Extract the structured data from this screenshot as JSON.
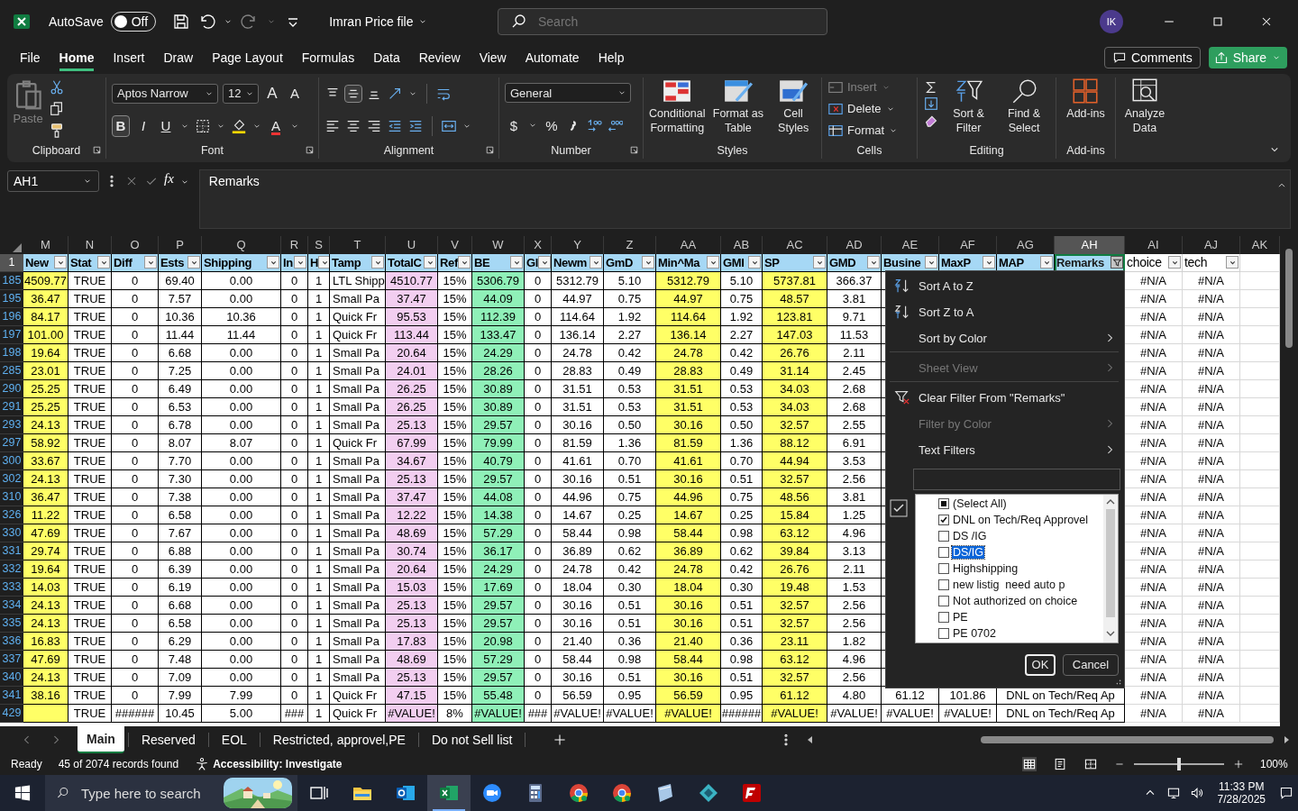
{
  "app": {
    "autosave_label": "AutoSave",
    "autosave": {
      "on": false,
      "label": "Off"
    },
    "title": "Imran Price file",
    "search_placeholder": "Search",
    "avatar": "IK"
  },
  "menu_tabs": [
    {
      "label": "File",
      "selected": false
    },
    {
      "label": "Home",
      "selected": true
    },
    {
      "label": "Insert",
      "selected": false
    },
    {
      "label": "Draw",
      "selected": false
    },
    {
      "label": "Page Layout",
      "selected": false
    },
    {
      "label": "Formulas",
      "selected": false
    },
    {
      "label": "Data",
      "selected": false
    },
    {
      "label": "Review",
      "selected": false
    },
    {
      "label": "View",
      "selected": false
    },
    {
      "label": "Automate",
      "selected": false
    },
    {
      "label": "Help",
      "selected": false
    }
  ],
  "comments": "Comments",
  "share": "Share",
  "ribbon": {
    "clipboard": {
      "label": "Clipboard",
      "paste": "Paste",
      "paste_disabled": true
    },
    "font": {
      "label": "Font",
      "family": "Aptos Narrow",
      "size": "12",
      "grow": "A",
      "shrink": "A",
      "bold": "B",
      "bold_on": true,
      "italic": "I",
      "underline": "U",
      "font_color": "A"
    },
    "alignment": {
      "label": "Alignment",
      "middle_on": true
    },
    "number": {
      "label": "Number",
      "format": "General",
      "currency": "$",
      "percent": "%"
    },
    "styles": {
      "label": "Styles",
      "buttons": [
        {
          "label": "Conditional Formatting",
          "kind": "conditional"
        },
        {
          "label": "Format as Table",
          "kind": "table"
        },
        {
          "label": "Cell Styles",
          "kind": "styles"
        }
      ]
    },
    "cells": {
      "label": "Cells",
      "buttons": [
        {
          "label": "Insert",
          "kind": "insert",
          "disabled": true
        },
        {
          "label": "Delete",
          "kind": "delete",
          "disabled": false
        },
        {
          "label": "Format",
          "kind": "format",
          "disabled": false
        }
      ]
    },
    "editing": {
      "label": "Editing",
      "buttons": [
        {
          "label": "Sort & Filter",
          "kind": "sort"
        },
        {
          "label": "Find & Select",
          "kind": "find"
        }
      ]
    },
    "addins": {
      "label": "Add-ins",
      "button": "Add-ins"
    },
    "analyze": "Analyze Data"
  },
  "formula_bar": {
    "name_box": "AH1",
    "function_label": "fx",
    "content": "Remarks"
  },
  "columns": [
    {
      "letter": "M",
      "header": "New",
      "color": "#ffff66",
      "in_table": true,
      "filtered": false,
      "selected": false
    },
    {
      "letter": "N",
      "header": "Stat",
      "in_table": true,
      "filtered": false,
      "selected": false
    },
    {
      "letter": "O",
      "header": "Diff",
      "in_table": true,
      "filtered": false,
      "selected": false
    },
    {
      "letter": "P",
      "header": "Ests",
      "in_table": true,
      "filtered": false,
      "selected": false
    },
    {
      "letter": "Q",
      "header": "Shipping",
      "in_table": true,
      "filtered": false,
      "selected": false
    },
    {
      "letter": "R",
      "header": "In",
      "in_table": true,
      "filtered": false,
      "selected": false
    },
    {
      "letter": "S",
      "header": "H",
      "in_table": true,
      "filtered": false,
      "selected": false
    },
    {
      "letter": "T",
      "header": "Tamp",
      "in_table": true,
      "filtered": false,
      "selected": false
    },
    {
      "letter": "U",
      "header": "TotalC",
      "color": "#f2cef0",
      "in_table": true,
      "filtered": false,
      "selected": false
    },
    {
      "letter": "V",
      "header": "Ref",
      "in_table": true,
      "filtered": false,
      "selected": false
    },
    {
      "letter": "W",
      "header": "BE",
      "color": "#8ff0b8",
      "in_table": true,
      "filtered": false,
      "selected": false
    },
    {
      "letter": "X",
      "header": "Gl",
      "in_table": true,
      "filtered": false,
      "selected": false
    },
    {
      "letter": "Y",
      "header": "Newm",
      "in_table": true,
      "filtered": false,
      "selected": false
    },
    {
      "letter": "Z",
      "header": "GmD",
      "in_table": true,
      "filtered": false,
      "selected": false
    },
    {
      "letter": "AA",
      "header": "Min^Ma",
      "color": "#ffff66",
      "in_table": true,
      "filtered": false,
      "selected": false
    },
    {
      "letter": "AB",
      "header": "GMI",
      "in_table": true,
      "filtered": false,
      "selected": false
    },
    {
      "letter": "AC",
      "header": "SP",
      "color": "#ffff66",
      "in_table": true,
      "filtered": false,
      "selected": false
    },
    {
      "letter": "AD",
      "header": "GMD",
      "in_table": true,
      "filtered": false,
      "selected": false
    },
    {
      "letter": "AE",
      "header": "Busine",
      "in_table": true,
      "filtered": false,
      "selected": false
    },
    {
      "letter": "AF",
      "header": "MaxP",
      "in_table": true,
      "filtered": false,
      "selected": false
    },
    {
      "letter": "AG",
      "header": "MAP",
      "in_table": true,
      "filtered": false,
      "selected": false
    },
    {
      "letter": "AH",
      "header": "Remarks",
      "in_table": true,
      "filtered": true,
      "selected": true
    },
    {
      "letter": "AI",
      "header": "choice",
      "in_table": false,
      "filtered": false,
      "selected": false
    },
    {
      "letter": "AJ",
      "header": "tech",
      "in_table": false,
      "filtered": false,
      "selected": false
    },
    {
      "letter": "AK",
      "selected": false
    }
  ],
  "header_row": "1",
  "rows": [
    {
      "num": "185",
      "cells": [
        "4509.77",
        "TRUE",
        "0",
        "69.40",
        "0.00",
        "0",
        "1",
        "LTL Shipp",
        "4510.77",
        "15%",
        "5306.79",
        "0",
        "5312.79",
        "5.10",
        "5312.79",
        "5.10",
        "5737.81",
        "366.37"
      ],
      "choice": "#N/A",
      "tech": "#N/A"
    },
    {
      "num": "195",
      "cells": [
        "36.47",
        "TRUE",
        "0",
        "7.57",
        "0.00",
        "0",
        "1",
        "Small Pa",
        "37.47",
        "15%",
        "44.09",
        "0",
        "44.97",
        "0.75",
        "44.97",
        "0.75",
        "48.57",
        "3.81"
      ],
      "choice": "#N/A",
      "tech": "#N/A"
    },
    {
      "num": "196",
      "cells": [
        "84.17",
        "TRUE",
        "0",
        "10.36",
        "10.36",
        "0",
        "1",
        "Quick Fr",
        "95.53",
        "15%",
        "112.39",
        "0",
        "114.64",
        "1.92",
        "114.64",
        "1.92",
        "123.81",
        "9.71"
      ],
      "choice": "#N/A",
      "tech": "#N/A"
    },
    {
      "num": "197",
      "cells": [
        "101.00",
        "TRUE",
        "0",
        "11.44",
        "11.44",
        "0",
        "1",
        "Quick Fr",
        "113.44",
        "15%",
        "133.47",
        "0",
        "136.14",
        "2.27",
        "136.14",
        "2.27",
        "147.03",
        "11.53"
      ],
      "choice": "#N/A",
      "tech": "#N/A"
    },
    {
      "num": "198",
      "cells": [
        "19.64",
        "TRUE",
        "0",
        "6.68",
        "0.00",
        "0",
        "1",
        "Small Pa",
        "20.64",
        "15%",
        "24.29",
        "0",
        "24.78",
        "0.42",
        "24.78",
        "0.42",
        "26.76",
        "2.11"
      ],
      "choice": "#N/A",
      "tech": "#N/A"
    },
    {
      "num": "285",
      "cells": [
        "23.01",
        "TRUE",
        "0",
        "7.25",
        "0.00",
        "0",
        "1",
        "Small Pa",
        "24.01",
        "15%",
        "28.26",
        "0",
        "28.83",
        "0.49",
        "28.83",
        "0.49",
        "31.14",
        "2.45"
      ],
      "choice": "#N/A",
      "tech": "#N/A"
    },
    {
      "num": "290",
      "cells": [
        "25.25",
        "TRUE",
        "0",
        "6.49",
        "0.00",
        "0",
        "1",
        "Small Pa",
        "26.25",
        "15%",
        "30.89",
        "0",
        "31.51",
        "0.53",
        "31.51",
        "0.53",
        "34.03",
        "2.68"
      ],
      "choice": "#N/A",
      "tech": "#N/A"
    },
    {
      "num": "291",
      "cells": [
        "25.25",
        "TRUE",
        "0",
        "6.53",
        "0.00",
        "0",
        "1",
        "Small Pa",
        "26.25",
        "15%",
        "30.89",
        "0",
        "31.51",
        "0.53",
        "31.51",
        "0.53",
        "34.03",
        "2.68"
      ],
      "choice": "#N/A",
      "tech": "#N/A"
    },
    {
      "num": "293",
      "cells": [
        "24.13",
        "TRUE",
        "0",
        "6.78",
        "0.00",
        "0",
        "1",
        "Small Pa",
        "25.13",
        "15%",
        "29.57",
        "0",
        "30.16",
        "0.50",
        "30.16",
        "0.50",
        "32.57",
        "2.55"
      ],
      "choice": "#N/A",
      "tech": "#N/A"
    },
    {
      "num": "297",
      "cells": [
        "58.92",
        "TRUE",
        "0",
        "8.07",
        "8.07",
        "0",
        "1",
        "Quick Fr",
        "67.99",
        "15%",
        "79.99",
        "0",
        "81.59",
        "1.36",
        "81.59",
        "1.36",
        "88.12",
        "6.91"
      ],
      "choice": "#N/A",
      "tech": "#N/A"
    },
    {
      "num": "300",
      "cells": [
        "33.67",
        "TRUE",
        "0",
        "7.70",
        "0.00",
        "0",
        "1",
        "Small Pa",
        "34.67",
        "15%",
        "40.79",
        "0",
        "41.61",
        "0.70",
        "41.61",
        "0.70",
        "44.94",
        "3.53"
      ],
      "choice": "#N/A",
      "tech": "#N/A"
    },
    {
      "num": "302",
      "cells": [
        "24.13",
        "TRUE",
        "0",
        "7.30",
        "0.00",
        "0",
        "1",
        "Small Pa",
        "25.13",
        "15%",
        "29.57",
        "0",
        "30.16",
        "0.51",
        "30.16",
        "0.51",
        "32.57",
        "2.56"
      ],
      "choice": "#N/A",
      "tech": "#N/A"
    },
    {
      "num": "310",
      "cells": [
        "36.47",
        "TRUE",
        "0",
        "7.38",
        "0.00",
        "0",
        "1",
        "Small Pa",
        "37.47",
        "15%",
        "44.08",
        "0",
        "44.96",
        "0.75",
        "44.96",
        "0.75",
        "48.56",
        "3.81"
      ],
      "choice": "#N/A",
      "tech": "#N/A"
    },
    {
      "num": "326",
      "cells": [
        "11.22",
        "TRUE",
        "0",
        "6.58",
        "0.00",
        "0",
        "1",
        "Small Pa",
        "12.22",
        "15%",
        "14.38",
        "0",
        "14.67",
        "0.25",
        "14.67",
        "0.25",
        "15.84",
        "1.25"
      ],
      "choice": "#N/A",
      "tech": "#N/A"
    },
    {
      "num": "330",
      "cells": [
        "47.69",
        "TRUE",
        "0",
        "7.67",
        "0.00",
        "0",
        "1",
        "Small Pa",
        "48.69",
        "15%",
        "57.29",
        "0",
        "58.44",
        "0.98",
        "58.44",
        "0.98",
        "63.12",
        "4.96"
      ],
      "choice": "#N/A",
      "tech": "#N/A"
    },
    {
      "num": "331",
      "cells": [
        "29.74",
        "TRUE",
        "0",
        "6.88",
        "0.00",
        "0",
        "1",
        "Small Pa",
        "30.74",
        "15%",
        "36.17",
        "0",
        "36.89",
        "0.62",
        "36.89",
        "0.62",
        "39.84",
        "3.13"
      ],
      "choice": "#N/A",
      "tech": "#N/A"
    },
    {
      "num": "332",
      "cells": [
        "19.64",
        "TRUE",
        "0",
        "6.39",
        "0.00",
        "0",
        "1",
        "Small Pa",
        "20.64",
        "15%",
        "24.29",
        "0",
        "24.78",
        "0.42",
        "24.78",
        "0.42",
        "26.76",
        "2.11"
      ],
      "choice": "#N/A",
      "tech": "#N/A"
    },
    {
      "num": "333",
      "cells": [
        "14.03",
        "TRUE",
        "0",
        "6.19",
        "0.00",
        "0",
        "1",
        "Small Pa",
        "15.03",
        "15%",
        "17.69",
        "0",
        "18.04",
        "0.30",
        "18.04",
        "0.30",
        "19.48",
        "1.53"
      ],
      "choice": "#N/A",
      "tech": "#N/A"
    },
    {
      "num": "334",
      "cells": [
        "24.13",
        "TRUE",
        "0",
        "6.68",
        "0.00",
        "0",
        "1",
        "Small Pa",
        "25.13",
        "15%",
        "29.57",
        "0",
        "30.16",
        "0.51",
        "30.16",
        "0.51",
        "32.57",
        "2.56"
      ],
      "choice": "#N/A",
      "tech": "#N/A"
    },
    {
      "num": "335",
      "cells": [
        "24.13",
        "TRUE",
        "0",
        "6.58",
        "0.00",
        "0",
        "1",
        "Small Pa",
        "25.13",
        "15%",
        "29.57",
        "0",
        "30.16",
        "0.51",
        "30.16",
        "0.51",
        "32.57",
        "2.56"
      ],
      "choice": "#N/A",
      "tech": "#N/A"
    },
    {
      "num": "336",
      "cells": [
        "16.83",
        "TRUE",
        "0",
        "6.29",
        "0.00",
        "0",
        "1",
        "Small Pa",
        "17.83",
        "15%",
        "20.98",
        "0",
        "21.40",
        "0.36",
        "21.40",
        "0.36",
        "23.11",
        "1.82"
      ],
      "choice": "#N/A",
      "tech": "#N/A"
    },
    {
      "num": "337",
      "cells": [
        "47.69",
        "TRUE",
        "0",
        "7.48",
        "0.00",
        "0",
        "1",
        "Small Pa",
        "48.69",
        "15%",
        "57.29",
        "0",
        "58.44",
        "0.98",
        "58.44",
        "0.98",
        "63.12",
        "4.96"
      ],
      "choice": "#N/A",
      "tech": "#N/A"
    },
    {
      "num": "340",
      "cells": [
        "24.13",
        "TRUE",
        "0",
        "7.09",
        "0.00",
        "0",
        "1",
        "Small Pa",
        "25.13",
        "15%",
        "29.57",
        "0",
        "30.16",
        "0.51",
        "30.16",
        "0.51",
        "32.57",
        "2.56"
      ],
      "choice": "#N/A",
      "tech": "#N/A"
    },
    {
      "num": "341",
      "cells": [
        "38.16",
        "TRUE",
        "0",
        "7.99",
        "7.99",
        "0",
        "1",
        "Quick Fr",
        "47.15",
        "15%",
        "55.48",
        "0",
        "56.59",
        "0.95",
        "56.59",
        "0.95",
        "61.12",
        "4.80"
      ],
      "after": [
        "61.12",
        "101.86",
        "DNL on Tech/Req Ap"
      ],
      "choice": "#N/A",
      "tech": "#N/A"
    },
    {
      "num": "429",
      "cells": [
        null,
        "TRUE",
        "######",
        "10.45",
        "5.00",
        "###",
        "1",
        "Quick Fr",
        "#VALUE!",
        "8%",
        "#VALUE!",
        "###",
        "#VALUE!",
        "#VALUE!",
        "#VALUE!",
        "######",
        "#VALUE!",
        "#VALUE!"
      ],
      "after": [
        "#VALUE!",
        "#VALUE!",
        "DNL on Tech/Req Ap"
      ],
      "choice": "#N/A",
      "tech": "#N/A"
    }
  ],
  "filter_menu": {
    "items": [
      {
        "label": "Sort A to Z",
        "kind": "sort-asc",
        "disabled": false,
        "submenu": false,
        "separator_after": false
      },
      {
        "label": "Sort Z to A",
        "kind": "sort-desc",
        "disabled": false,
        "submenu": false,
        "separator_after": false
      },
      {
        "label": "Sort by Color",
        "kind": "plain",
        "disabled": false,
        "submenu": true,
        "separator_after": true
      },
      {
        "label": "Sheet View",
        "kind": "plain",
        "disabled": true,
        "submenu": true,
        "separator_after": true
      },
      {
        "label": "Clear Filter From \"Remarks\"",
        "kind": "clear",
        "disabled": false,
        "submenu": false,
        "separator_after": false
      },
      {
        "label": "Filter by Color",
        "kind": "plain",
        "disabled": true,
        "submenu": true,
        "separator_after": false
      },
      {
        "label": "Text Filters",
        "kind": "plain",
        "disabled": false,
        "submenu": true,
        "separator_after": false
      }
    ],
    "values": [
      {
        "label": "(Select All)",
        "checked": true,
        "partial": true,
        "selected": false
      },
      {
        "label": "DNL on Tech/Req Approvel",
        "checked": true,
        "partial": false,
        "selected": false
      },
      {
        "label": "DS /IG",
        "checked": false,
        "partial": false,
        "selected": false
      },
      {
        "label": "DS/IG",
        "checked": false,
        "partial": false,
        "selected": true
      },
      {
        "label": "Highshipping",
        "checked": false,
        "partial": false,
        "selected": false
      },
      {
        "label": "new listig  need auto p",
        "checked": false,
        "partial": false,
        "selected": false
      },
      {
        "label": "Not authorized on choice",
        "checked": false,
        "partial": false,
        "selected": false
      },
      {
        "label": "PE",
        "checked": false,
        "partial": false,
        "selected": false
      },
      {
        "label": "PE 0702",
        "checked": false,
        "partial": false,
        "selected": false
      }
    ],
    "ok": "OK",
    "cancel": "Cancel"
  },
  "sheets": [
    {
      "label": "Main",
      "selected": true
    },
    {
      "label": "Reserved",
      "selected": false
    },
    {
      "label": "EOL",
      "selected": false
    },
    {
      "label": "Restricted, approvel,PE",
      "selected": false
    },
    {
      "label": "Do not Sell list",
      "selected": false
    }
  ],
  "status_bar": {
    "ready": "Ready",
    "records": "45 of 2074 records found",
    "accessibility": "Accessibility: Investigate",
    "zoom": "100%",
    "zoom_slider": {
      "level": 0.5
    }
  },
  "taskbar": {
    "search_placeholder": "Type here to search",
    "apps": [
      {
        "kind": "task-view",
        "active": false
      },
      {
        "kind": "explorer",
        "active": false
      },
      {
        "kind": "outlook",
        "active": false
      },
      {
        "kind": "excel",
        "active": true
      },
      {
        "kind": "zoom",
        "active": false
      },
      {
        "kind": "calculator",
        "active": false
      },
      {
        "kind": "chrome",
        "active": false
      },
      {
        "kind": "chrome",
        "active": false
      },
      {
        "kind": "notes",
        "active": false
      },
      {
        "kind": "diamond",
        "active": false
      },
      {
        "kind": "filezilla",
        "active": false
      }
    ],
    "time": "11:33 PM",
    "date": "7/28/2025"
  }
}
